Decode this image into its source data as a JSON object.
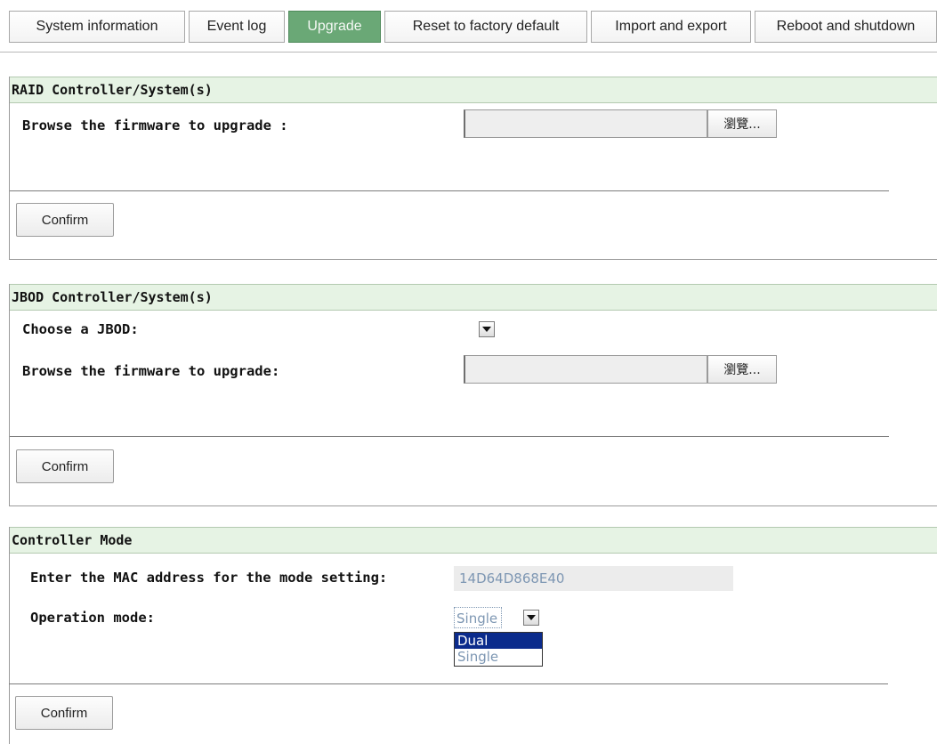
{
  "tabs": [
    {
      "label": "System information",
      "active": false
    },
    {
      "label": "Event log",
      "active": false
    },
    {
      "label": "Upgrade",
      "active": true
    },
    {
      "label": "Reset to factory default",
      "active": false
    },
    {
      "label": "Import and export",
      "active": false
    },
    {
      "label": "Reboot and shutdown",
      "active": false
    }
  ],
  "raid": {
    "title": "RAID Controller/System(s)",
    "browse_label": "Browse the firmware to upgrade :",
    "file_value": "",
    "browse_button": "瀏覽...",
    "confirm_button": "Confirm"
  },
  "jbod": {
    "title": "JBOD Controller/System(s)",
    "choose_label": "Choose a JBOD:",
    "choose_value": "",
    "browse_label": "Browse the firmware to upgrade:",
    "file_value": "",
    "browse_button": "瀏覽...",
    "confirm_button": "Confirm"
  },
  "controller_mode": {
    "title": "Controller Mode",
    "mac_label": "Enter the MAC address for the mode setting:",
    "mac_value": "14D64D868E40",
    "operation_label": "Operation mode:",
    "operation_selected": "Single",
    "operation_options": [
      "Dual",
      "Single"
    ],
    "highlighted_option": "Dual",
    "confirm_button": "Confirm"
  },
  "colors": {
    "active_tab": "#6aa876",
    "section_header": "#e6f3e4",
    "dropdown_highlight": "#0b2b8c",
    "disabled_text": "#7e97b3"
  }
}
